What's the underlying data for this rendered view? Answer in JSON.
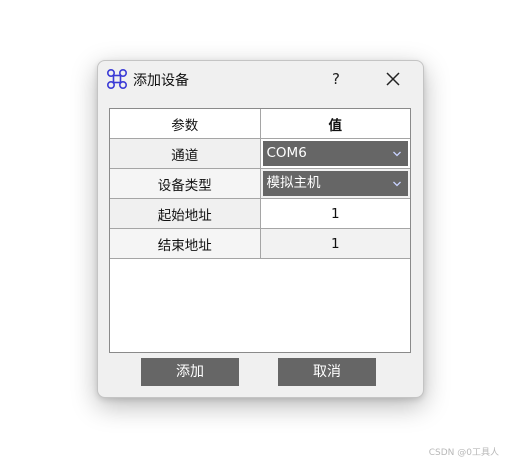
{
  "dialog": {
    "title": "添加设备",
    "help_label": "?",
    "icons": {
      "app": "command-icon",
      "close": "close-icon",
      "dropdown": "chevron-down-icon"
    }
  },
  "table": {
    "headers": [
      "参数",
      "值"
    ],
    "rows": [
      {
        "param": "通道",
        "value": "COM6",
        "type": "combo"
      },
      {
        "param": "设备类型",
        "value": "模拟主机",
        "type": "combo"
      },
      {
        "param": "起始地址",
        "value": "1",
        "type": "text"
      },
      {
        "param": "结束地址",
        "value": "1",
        "type": "text"
      }
    ]
  },
  "buttons": {
    "add": "添加",
    "cancel": "取消"
  },
  "watermark": "CSDN @0工具人",
  "colors": {
    "accent_icon": "#3b3bd6",
    "button_bg": "#666666",
    "combo_bg": "#666666",
    "dialog_bg": "#f0f0f0"
  }
}
